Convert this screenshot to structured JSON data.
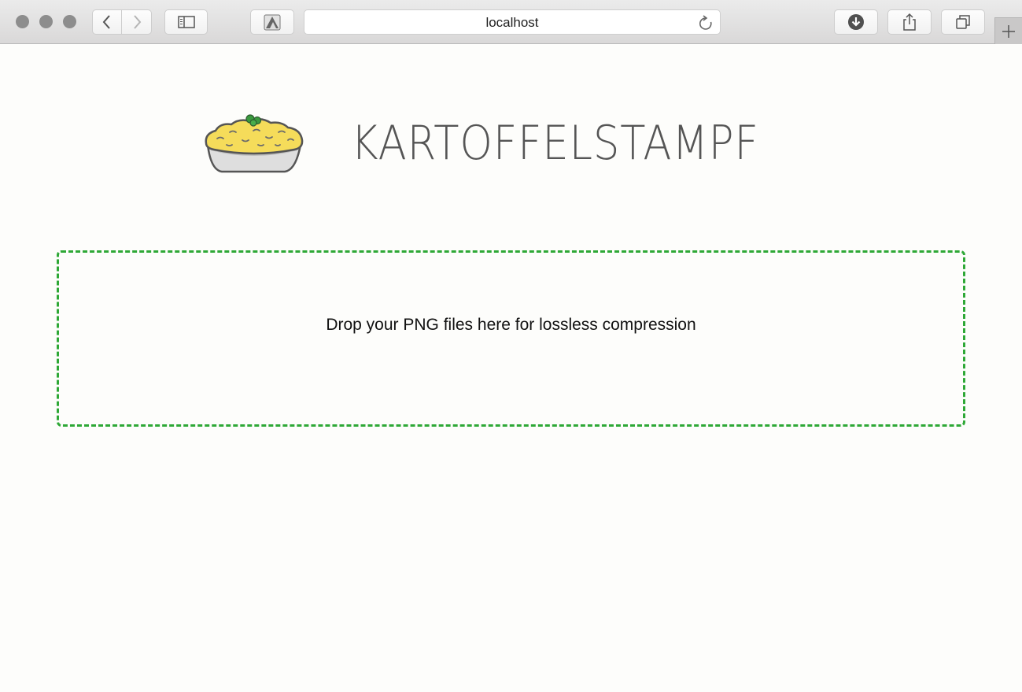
{
  "browser": {
    "address_text": "localhost",
    "icons": {
      "back": "chevron-left-icon",
      "forward": "chevron-right-icon",
      "sidebar": "sidebar-icon",
      "reader": "reader-icon",
      "reload": "reload-icon",
      "download": "download-icon",
      "share": "share-icon",
      "tabs": "tabs-overview-icon",
      "new_tab": "plus-icon"
    }
  },
  "page": {
    "title": "KARTOFFELSTAMPF",
    "logo": "mashed-potato-bowl-icon",
    "dropzone_text": "Drop your PNG files here for lossless compression"
  },
  "colors": {
    "dropzone_border": "#2ea836",
    "title_text": "#555555",
    "potato": "#f5dc5a",
    "herb": "#3a9a3e"
  }
}
